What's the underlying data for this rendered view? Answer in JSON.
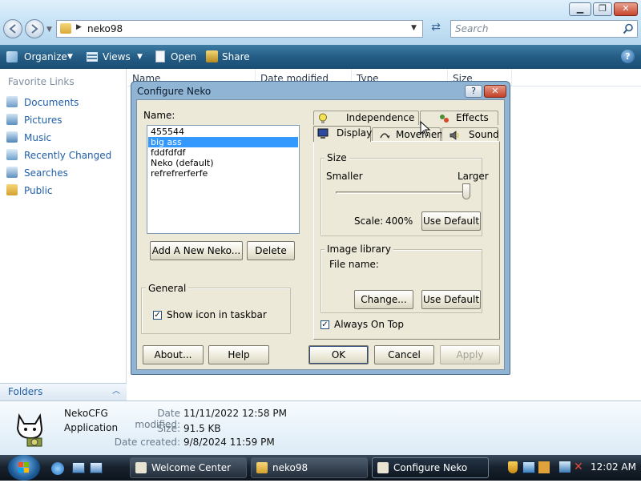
{
  "explorer": {
    "path_folder": "neko98",
    "search_placeholder": "Search",
    "toolbar": {
      "organize": "Organize",
      "views": "Views",
      "open": "Open",
      "share": "Share"
    },
    "sidebar": {
      "heading": "Favorite Links",
      "items": [
        "Documents",
        "Pictures",
        "Music",
        "Recently Changed",
        "Searches",
        "Public"
      ],
      "folders_label": "Folders"
    },
    "columns": [
      "Name",
      "Date modified",
      "Type",
      "Size"
    ],
    "details": {
      "name": "NekoCFG",
      "type": "Application",
      "modified_label": "Date modified:",
      "modified_value": "11/11/2022 12:58 PM",
      "size_label": "Size:",
      "size_value": "91.5 KB",
      "created_label": "Date created:",
      "created_value": "9/8/2024 11:59 PM"
    }
  },
  "dialog": {
    "title": "Configure Neko",
    "help_glyph": "?",
    "close_glyph": "✕",
    "name_label": "Name:",
    "neko_list": [
      "455544",
      "big ass",
      "fddfdfdf",
      "Neko (default)",
      "refrefrerferfe"
    ],
    "selected_index": 1,
    "add_button": "Add A New Neko...",
    "delete_button": "Delete",
    "general_group": "General",
    "show_icon_label": "Show icon in taskbar",
    "show_icon_checked": true,
    "tabs_top": [
      "Independence",
      "Effects"
    ],
    "tabs_bottom": [
      "Display",
      "Movement",
      "Sound"
    ],
    "active_tab": "Display",
    "size_group": "Size",
    "smaller_label": "Smaller",
    "larger_label": "Larger",
    "scale_label": "Scale:",
    "scale_value": "400%",
    "slider_level": 1.0,
    "use_default_1": "Use Default",
    "image_group": "Image library",
    "file_name_label": "File name:",
    "change_button": "Change...",
    "use_default_2": "Use Default",
    "always_on_top_label": "Always On Top",
    "always_on_top_checked": true,
    "about_button": "About...",
    "help_button": "Help",
    "ok_button": "OK",
    "cancel_button": "Cancel",
    "apply_button": "Apply"
  },
  "taskbar": {
    "tasks": [
      "Welcome Center",
      "neko98",
      "Configure Neko"
    ],
    "clock": "12:02 AM"
  },
  "colors": {
    "selection": "#3399ff",
    "toolbar": "#245d86",
    "dialog_face": "#ece9d8",
    "link": "#1f5fa8"
  }
}
